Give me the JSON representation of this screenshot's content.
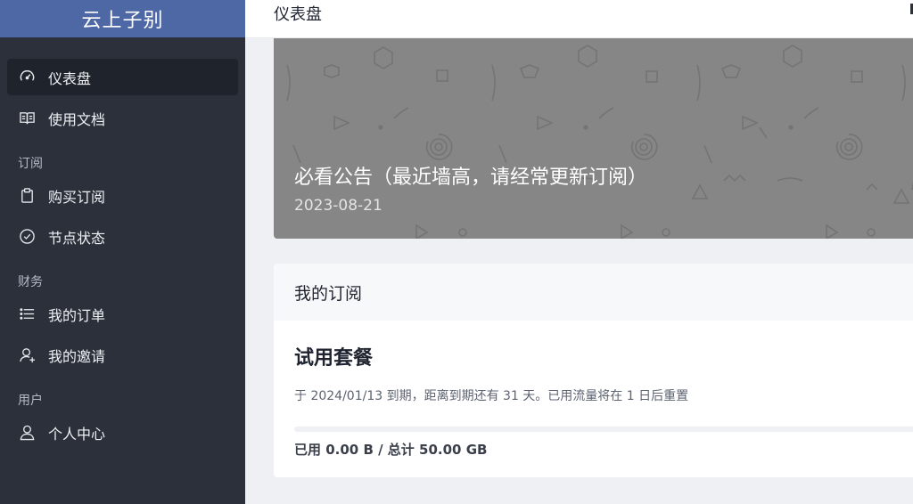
{
  "sidebar": {
    "brand": "云上子别",
    "items": [
      {
        "label": "仪表盘",
        "icon": "dashboard-icon",
        "active": true
      },
      {
        "label": "使用文档",
        "icon": "book-icon"
      }
    ],
    "sections": [
      {
        "title": "订阅",
        "items": [
          {
            "label": "购买订阅",
            "icon": "clipboard-icon"
          },
          {
            "label": "节点状态",
            "icon": "check-circle-icon"
          }
        ]
      },
      {
        "title": "财务",
        "items": [
          {
            "label": "我的订单",
            "icon": "list-icon"
          },
          {
            "label": "我的邀请",
            "icon": "invite-user-icon"
          }
        ]
      },
      {
        "title": "用户",
        "items": [
          {
            "label": "个人中心",
            "icon": "user-icon"
          }
        ]
      }
    ]
  },
  "header": {
    "title": "仪表盘"
  },
  "announcement": {
    "title": "必看公告（最近墙高，请经常更新订阅）",
    "date": "2023-08-21"
  },
  "subscription": {
    "header": "我的订阅",
    "plan_name": "试用套餐",
    "expire_text": "于 2024/01/13 到期，距离到期还有 31 天。已用流量将在 1 日后重置",
    "usage_text": "已用 0.00 B / 总计 50.00 GB",
    "usage_fraction": 0,
    "accent": "#4d68a5"
  }
}
